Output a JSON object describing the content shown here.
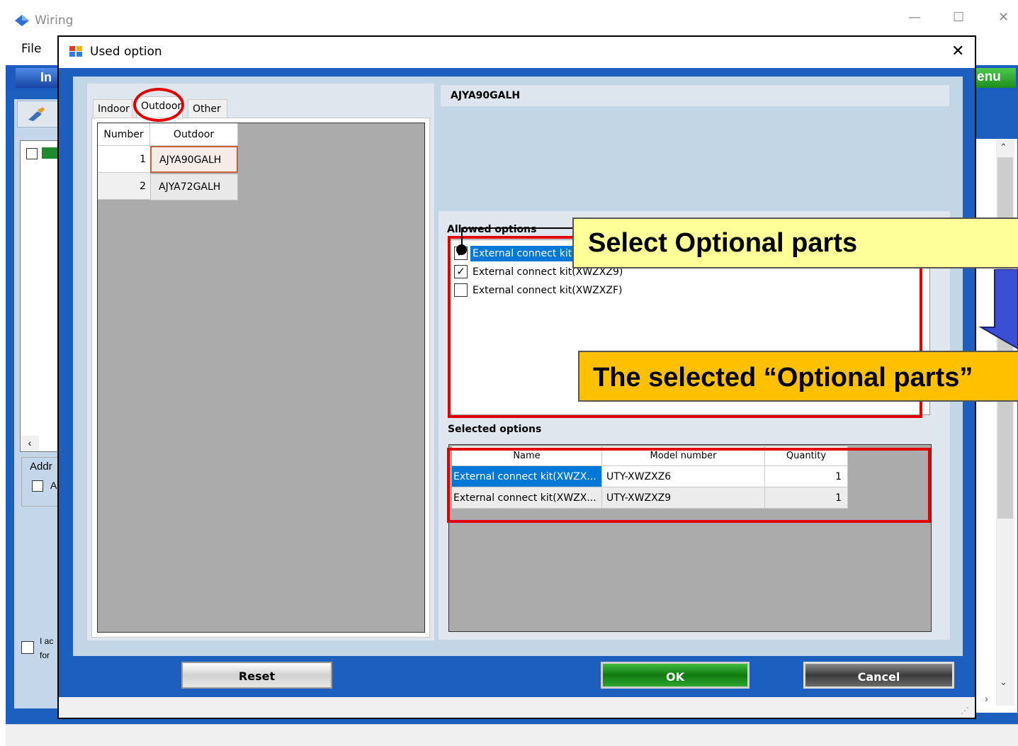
{
  "background_window": {
    "title": "Wiring",
    "menu_file": "File",
    "tab_partial": "In",
    "menu_partial": "enu",
    "address_partial": "Addr",
    "checkbox_partial_a": "A",
    "accept_partial_1": "I ac",
    "accept_partial_2": "for",
    "minimize": "—",
    "maximize": "☐",
    "close": "✕"
  },
  "dialog": {
    "title": "Used option",
    "close": "✕"
  },
  "tabs": {
    "indoor": "Indoor",
    "outdoor": "Outdoor",
    "other": "Other"
  },
  "outdoor_grid": {
    "headers": {
      "number": "Number",
      "outdoor": "Outdoor"
    },
    "rows": [
      {
        "number": "1",
        "outdoor": "AJYA90GALH"
      },
      {
        "number": "2",
        "outdoor": "AJYA72GALH"
      }
    ]
  },
  "model_header": "AJYA90GALH",
  "allowed_options": {
    "label": "Allowed options",
    "items": [
      {
        "label": "External connect kit(XWZXZ6)",
        "checked": true,
        "visible_label": "External connect kit("
      },
      {
        "label": "External connect kit(XWZXZ9)",
        "checked": true
      },
      {
        "label": "External connect kit(XWZXZF)",
        "checked": false
      }
    ]
  },
  "selected_options": {
    "label": "Selected options",
    "headers": {
      "name": "Name",
      "model": "Model number",
      "quantity": "Quantity"
    },
    "rows": [
      {
        "name": "External connect kit(XWZX...",
        "model": "UTY-XWZXZ6",
        "quantity": "1"
      },
      {
        "name": "External connect kit(XWZX...",
        "model": "UTY-XWZXZ9",
        "quantity": "1"
      }
    ]
  },
  "buttons": {
    "reset": "Reset",
    "ok": "OK",
    "cancel": "Cancel"
  },
  "annotations": {
    "select_callout": "Select Optional parts",
    "selected_callout": "The selected “Optional parts”",
    "highlight_color": "#e00000",
    "callout_yellow": "#ffff99",
    "callout_orange": "#ffc000"
  }
}
